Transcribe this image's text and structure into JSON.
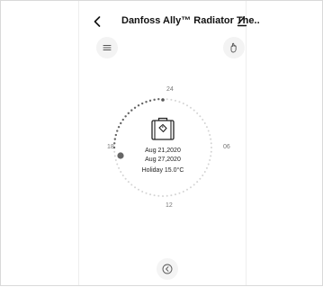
{
  "header": {
    "title": "Danfoss Ally™ Radiator The..",
    "back_icon": "chevron-left-icon",
    "edit_icon": "pencil-icon"
  },
  "toolbar": {
    "menu_icon": "hamburger-menu-icon",
    "hand_icon": "hand-gesture-icon"
  },
  "dial": {
    "labels": {
      "top": "24",
      "right": "06",
      "bottom": "12",
      "left": "18"
    },
    "center_icon": "suitcase-icon",
    "start_date": "Aug 21,2020",
    "end_date": "Aug 27,2020",
    "mode_text": "Holiday 15.0°C",
    "active_color": "#666666",
    "inactive_color": "#d4d4d4"
  },
  "bottom": {
    "icon": "chevron-left-circle-icon"
  }
}
